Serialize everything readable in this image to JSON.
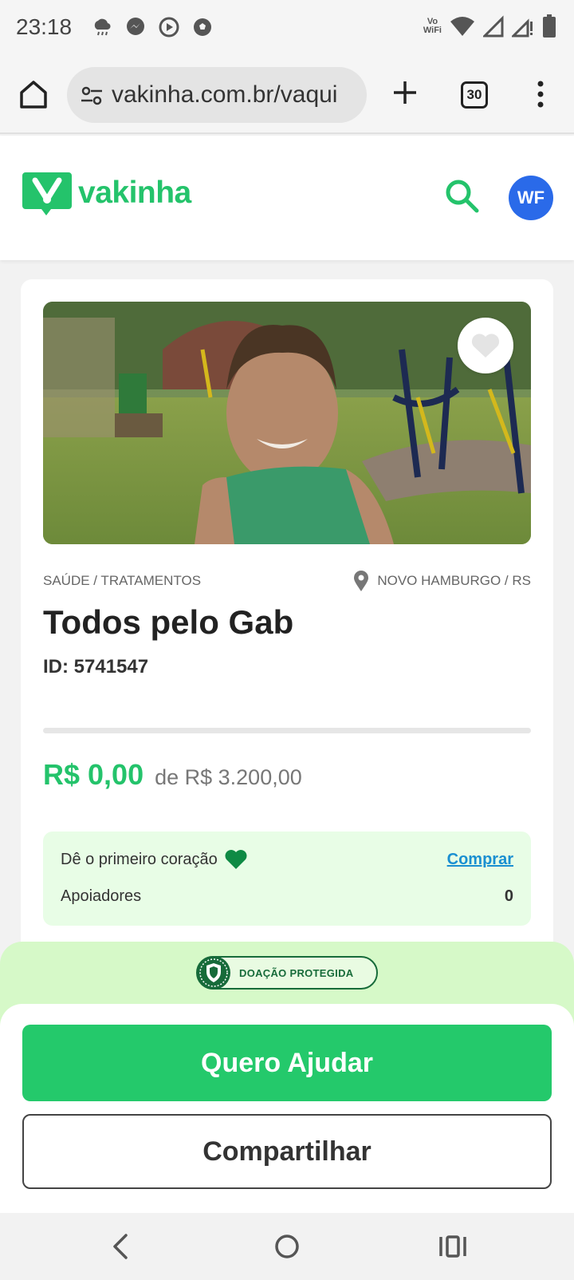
{
  "status_bar": {
    "time": "23:18",
    "vowifi_line1": "Vo",
    "vowifi_line2": "WiFi",
    "icons": [
      "cloud-rain-icon",
      "messenger-icon",
      "media-play-icon",
      "soccer-ball-icon",
      "vowifi-icon",
      "wifi-icon",
      "signal-icon",
      "signal-no-data-icon",
      "battery-icon"
    ]
  },
  "browser": {
    "url": "vakinha.com.br/vaqui",
    "tab_count": "30"
  },
  "site": {
    "logo_text": "vakinha",
    "avatar_initials": "WF"
  },
  "campaign": {
    "category": "SAÚDE / TRATAMENTOS",
    "location": "NOVO HAMBURGO / RS",
    "title": "Todos pelo Gab",
    "id_label": "ID: 5741547",
    "raised": "R$ 0,00",
    "goal": "de R$ 3.200,00",
    "progress_fraction": 0,
    "hearts_text": "Dê o primeiro coração",
    "buy_label": "Comprar",
    "supporters_label": "Apoiadores",
    "supporters_count": "0"
  },
  "actions": {
    "protected_label": "DOAÇÃO PROTEGIDA",
    "primary_label": "Quero Ajudar",
    "secondary_label": "Compartilhar"
  },
  "colors": {
    "brand_green": "#24c36b",
    "avatar_blue": "#2a6ae9",
    "link_blue": "#1a8fd1",
    "panel_green": "#d6f9c8"
  }
}
